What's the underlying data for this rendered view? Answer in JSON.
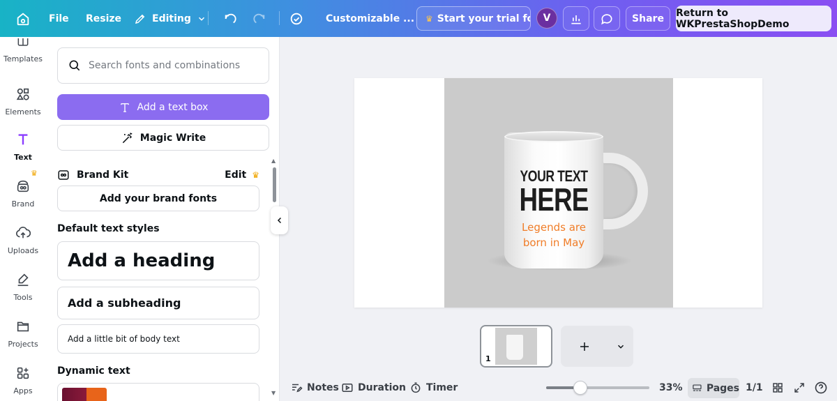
{
  "topbar": {
    "file_label": "File",
    "resize_label": "Resize",
    "editing_label": "Editing",
    "design_title": "Customizable ...",
    "trial_label": "Start your trial fo...",
    "avatar_initial": "V",
    "share_label": "Share",
    "return_label": "Return to WKPrestaShopDemo"
  },
  "rail": {
    "items": [
      {
        "label": "Templates",
        "icon": "template-icon"
      },
      {
        "label": "Elements",
        "icon": "elements-icon"
      },
      {
        "label": "Text",
        "icon": "text-icon"
      },
      {
        "label": "Brand",
        "icon": "brand-icon"
      },
      {
        "label": "Uploads",
        "icon": "upload-icon"
      },
      {
        "label": "Tools",
        "icon": "tools-icon"
      },
      {
        "label": "Projects",
        "icon": "folder-icon"
      },
      {
        "label": "Apps",
        "icon": "apps-icon"
      }
    ],
    "active": "Text"
  },
  "panel": {
    "search_placeholder": "Search fonts and combinations",
    "add_textbox_label": "Add a text box",
    "magic_write_label": "Magic Write",
    "brand_kit_label": "Brand Kit",
    "brand_edit_label": "Edit",
    "add_brand_fonts_label": "Add your brand fonts",
    "default_styles_title": "Default text styles",
    "heading_label": "Add a heading",
    "subheading_label": "Add a subheading",
    "body_label": "Add a little bit of body text",
    "dynamic_text_title": "Dynamic text"
  },
  "canvas": {
    "mug_line1": "YOUR TEXT",
    "mug_line2": "HERE",
    "mug_caption": "Legends are born in May"
  },
  "pages": {
    "thumb_number": "1"
  },
  "bottombar": {
    "notes_label": "Notes",
    "duration_label": "Duration",
    "timer_label": "Timer",
    "zoom_level": "33%",
    "zoom_fraction": 0.33,
    "pages_label": "Pages",
    "page_count": "1/1"
  },
  "colors": {
    "accent_purple": "#8b6cf0",
    "caption_orange": "#f07d28",
    "premium_crown": "#f0a500"
  }
}
